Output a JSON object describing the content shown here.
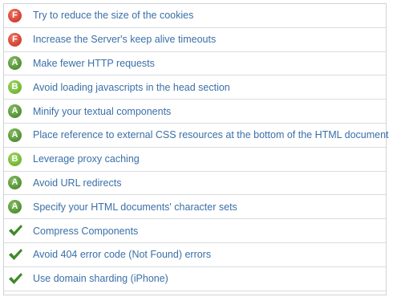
{
  "colors": {
    "link_text": "#3a6fa8",
    "grade_F": "#d84a3a",
    "grade_A": "#5c9a3c",
    "grade_B": "#7bbf3c",
    "check": "#3f8a2a",
    "row_divider": "#d9dcde"
  },
  "rules": [
    {
      "grade": "F",
      "text": "Try to reduce the size of the cookies"
    },
    {
      "grade": "F",
      "text": "Increase the Server's keep alive timeouts"
    },
    {
      "grade": "A",
      "text": "Make fewer HTTP requests"
    },
    {
      "grade": "B",
      "text": "Avoid loading javascripts in the head section"
    },
    {
      "grade": "A",
      "text": "Minify your textual components"
    },
    {
      "grade": "A",
      "text": "Place reference to external CSS resources at the bottom of the HTML document"
    },
    {
      "grade": "B",
      "text": "Leverage proxy caching"
    },
    {
      "grade": "A",
      "text": "Avoid URL redirects"
    },
    {
      "grade": "A",
      "text": "Specify your HTML documents' character sets"
    },
    {
      "grade": "check",
      "icon": "checkmark-icon",
      "text": "Compress Components"
    },
    {
      "grade": "check",
      "icon": "checkmark-icon",
      "text": "Avoid 404 error code (Not Found) errors"
    },
    {
      "grade": "check",
      "icon": "checkmark-icon",
      "text": "Use domain sharding (iPhone)"
    }
  ]
}
